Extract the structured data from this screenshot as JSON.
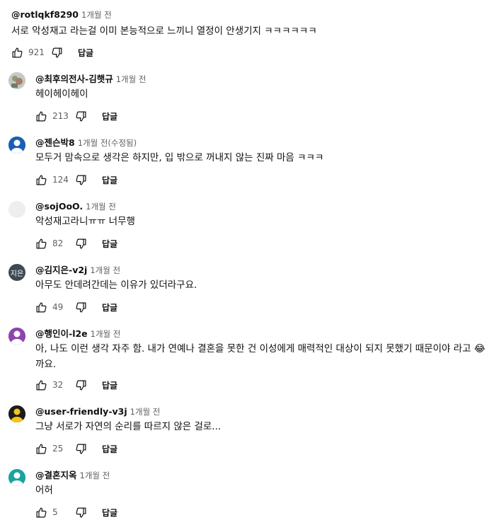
{
  "comments": [
    {
      "author": "@rotlqkf8290",
      "time": "1개월 전",
      "text": "서로 악성재고 라는걸 이미 본능적으로 느끼니 열정이 안생기지 ㅋㅋㅋㅋㅋㅋ",
      "likes": "921",
      "reply_label": "답글",
      "avatar": {
        "type": "none"
      }
    },
    {
      "author": "@최후의전사-김햇규",
      "time": "1개월 전",
      "text": "헤이헤이헤이",
      "likes": "213",
      "reply_label": "답글",
      "avatar": {
        "type": "photo",
        "color": "#c7c9c4"
      }
    },
    {
      "author": "@젠슨박8",
      "time": "1개월 전(수정됨)",
      "text": "모두거 맘속으로 생각은 하지만, 입 밖으로 꺼내지 않는 진짜 마음 ㅋㅋㅋ",
      "likes": "124",
      "reply_label": "답글",
      "avatar": {
        "type": "person",
        "color": "#1a5fb4"
      }
    },
    {
      "author": "@sojOoO.",
      "time": "1개월 전",
      "text": "악성재고라니ㅠㅠ 너무행",
      "likes": "82",
      "reply_label": "답글",
      "avatar": {
        "type": "blank",
        "color": "#eeeeee"
      }
    },
    {
      "author": "@김지은-v2j",
      "time": "1개월 전",
      "text": "아무도 안데려간데는 이유가 있더라구요.",
      "likes": "49",
      "reply_label": "답글",
      "avatar": {
        "type": "initials",
        "initials": "지은",
        "color": "#3d4a55"
      }
    },
    {
      "author": "@행인이-l2e",
      "time": "1개월 전",
      "text": "아, 나도 이런 생각 자주 함. 내가 연예나 결혼을 못한 건 이성에게 매력적인 대상이 되지 못했기 때문이야 라고 😂 까요.",
      "likes": "32",
      "reply_label": "답글",
      "avatar": {
        "type": "person",
        "color": "#8e44ad"
      }
    },
    {
      "author": "@user-friendly-v3j",
      "time": "1개월 전",
      "text": "그냥 서로가 자연의 순리를 따르지 않은 걸로...",
      "likes": "25",
      "reply_label": "답글",
      "avatar": {
        "type": "person",
        "color": "#1c1c1c",
        "accent": "#f5c518"
      }
    },
    {
      "author": "@결혼지옥",
      "time": "1개월 전",
      "text": "어허",
      "likes": "5",
      "reply_label": "답글",
      "avatar": {
        "type": "person",
        "color": "#1aa3a0"
      }
    }
  ],
  "icons": {
    "like": "thumb-up-icon",
    "dislike": "thumb-down-icon"
  }
}
